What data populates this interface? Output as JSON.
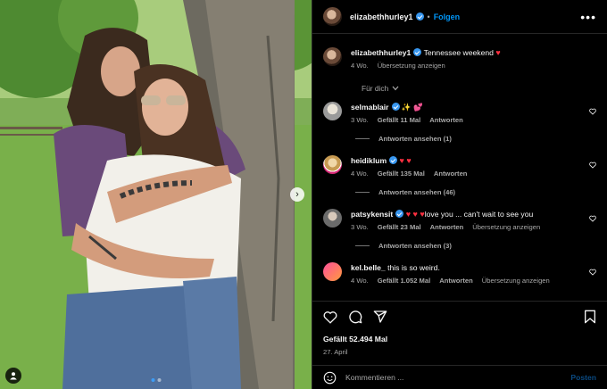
{
  "header": {
    "username": "elizabethhurley1",
    "separator": "•",
    "follow_label": "Folgen",
    "more_label": "•••"
  },
  "caption": {
    "username": "elizabethhurley1",
    "text": "Tennessee weekend",
    "emoji": "♥",
    "age": "4 Wo.",
    "translate": "Übersetzung anzeigen"
  },
  "for_you_label": "Für dich",
  "comments": [
    {
      "username": "selmablair",
      "text": "",
      "emoji": "✨ 💕",
      "age": "3 Wo.",
      "likes": "Gefällt 11 Mal",
      "reply": "Antworten",
      "extra": "",
      "view_replies": "Antworten ansehen (1)"
    },
    {
      "username": "heidiklum",
      "text": "",
      "emoji": "♥ ♥",
      "age": "4 Wo.",
      "likes": "Gefällt 135 Mal",
      "reply": "Antworten",
      "extra": "",
      "view_replies": "Antworten ansehen (46)"
    },
    {
      "username": "patsykensit",
      "text": "love you ... can't wait to see you",
      "emoji": "♥ ♥ ♥",
      "age": "3 Wo.",
      "likes": "Gefällt 23 Mal",
      "reply": "Antworten",
      "extra": "Übersetzung anzeigen",
      "view_replies": "Antworten ansehen (3)"
    },
    {
      "username": "kel.belle_",
      "text": "this is so weird.",
      "emoji": "",
      "age": "4 Wo.",
      "likes": "Gefällt 1.052 Mal",
      "reply": "Antworten",
      "extra": "Übersetzung anzeigen",
      "view_replies": ""
    }
  ],
  "post": {
    "likes": "Gefällt 52.494 Mal",
    "date": "27. April"
  },
  "compose": {
    "placeholder": "Kommentieren ...",
    "post_label": "Posten"
  },
  "colors": {
    "accent": "#0095f6",
    "heart": "#ff3040",
    "muted": "#a8a8a8"
  }
}
